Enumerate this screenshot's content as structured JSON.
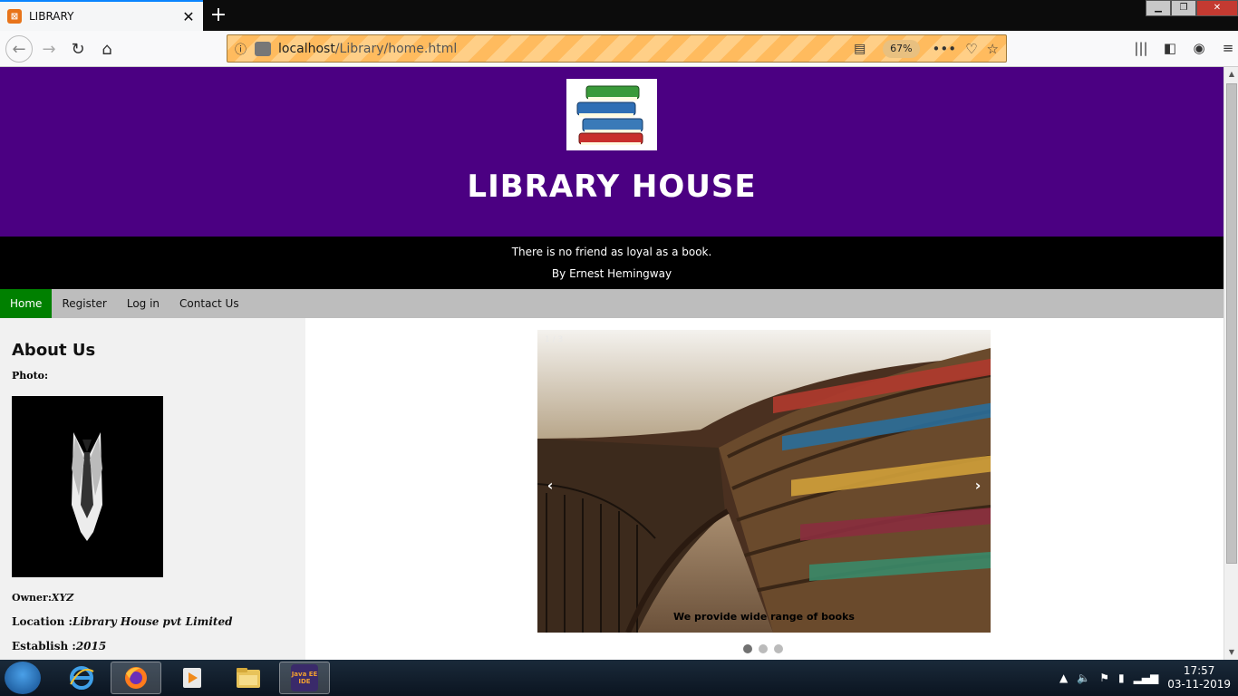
{
  "browser": {
    "tab_title": "LIBRARY",
    "tab_favicon": "xampp-icon",
    "url_host": "localhost",
    "url_path": "/Library/home.html",
    "zoom": "67%"
  },
  "page": {
    "site_title": "LIBRARY HOUSE",
    "quote": "There is no friend as loyal as a book.",
    "quote_author": "By Ernest Hemingway",
    "menu": [
      {
        "label": "Home",
        "active": true
      },
      {
        "label": "Register",
        "active": false
      },
      {
        "label": "Log in",
        "active": false
      },
      {
        "label": "Contact Us",
        "active": false
      }
    ],
    "about": {
      "title": "About Us",
      "photo_label": "Photo:",
      "owner_label": "Owner:",
      "owner_value": "XYZ",
      "location_label": "Location :",
      "location_value": "Library House pvt Limited",
      "establish_label": "Establish :",
      "establish_value": "2015"
    },
    "slideshow": {
      "counter": "1 / 3",
      "caption": "We provide wide range of books",
      "prev": "‹",
      "next": "›",
      "active_slide": 1,
      "slide_count": 3
    }
  },
  "taskbar": {
    "apps": [
      "internet-explorer",
      "firefox",
      "media-player",
      "file-explorer",
      "java-ee-ide"
    ],
    "java_label": "Java EE IDE",
    "time": "17:57",
    "date": "03-11-2019"
  }
}
